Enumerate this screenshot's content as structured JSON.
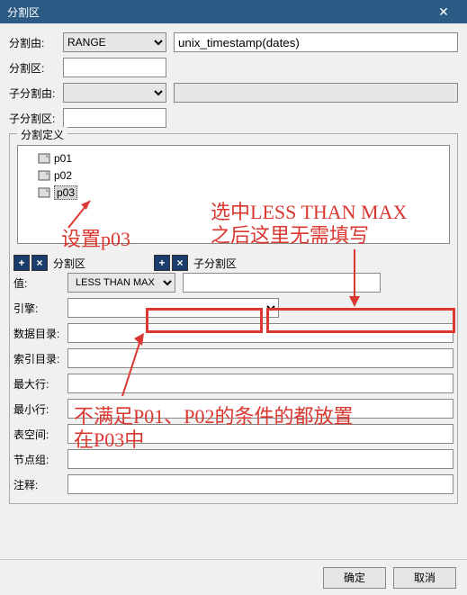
{
  "window": {
    "title": "分割区"
  },
  "rows": {
    "partition_by_label": "分割由:",
    "partition_by_select": "RANGE",
    "partition_by_expr": "unix_timestamp(dates)",
    "partition_name_label": "分割区:",
    "partition_name_value": "",
    "subpartition_by_label": "子分割由:",
    "subpartition_by_select": "",
    "subpartition_by_expr": "",
    "subpartition_name_label": "子分割区:",
    "subpartition_name_value": ""
  },
  "fieldset_legend": "分割定义",
  "tree": [
    {
      "label": "p01",
      "selected": false
    },
    {
      "label": "p02",
      "selected": false
    },
    {
      "label": "p03",
      "selected": true
    }
  ],
  "toolbar": {
    "partition_label": "分割区",
    "subpartition_label": "子分割区"
  },
  "form": {
    "value_label": "值:",
    "value_select": "LESS THAN MAX",
    "value_input": "",
    "engine_label": "引擎:",
    "engine_value": "",
    "data_dir_label": "数据目录:",
    "data_dir_value": "",
    "index_dir_label": "索引目录:",
    "index_dir_value": "",
    "max_rows_label": "最大行:",
    "max_rows_value": "",
    "min_rows_label": "最小行:",
    "min_rows_value": "",
    "tablespace_label": "表空间:",
    "tablespace_value": "",
    "nodegroup_label": "节点组:",
    "nodegroup_value": "",
    "comment_label": "注释:",
    "comment_value": ""
  },
  "buttons": {
    "ok": "确定",
    "cancel": "取消"
  },
  "annotations": {
    "set_p03": "设置p03",
    "less_than_max_note_1": "选中LESS THAN MAX",
    "less_than_max_note_2": "之后这里无需填写",
    "bottom_note_1": "不满足P01、P02的条件的都放置",
    "bottom_note_2": "在P03中"
  }
}
